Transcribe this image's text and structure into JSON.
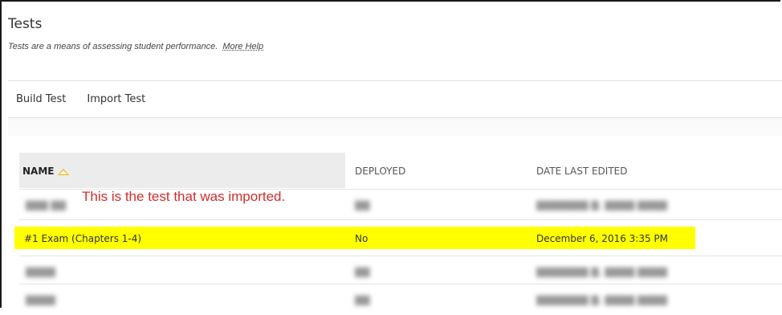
{
  "page": {
    "title": "Tests",
    "description": "Tests are a means of assessing student performance.",
    "more_help": "More Help"
  },
  "toolbar": {
    "build_test": "Build Test",
    "import_test": "Import Test"
  },
  "table": {
    "columns": {
      "name": "NAME",
      "deployed": "DEPLOYED",
      "date": "DATE LAST EDITED"
    },
    "sort_icon": "triangle-up-icon",
    "highlighted_row": {
      "name": "#1 Exam (Chapters 1-4)",
      "deployed": "No",
      "date": "December 6, 2016 3:35 PM"
    }
  },
  "annotation": "This is the test that was imported.",
  "colors": {
    "highlight": "#ffff00",
    "annotation": "#d22c2c"
  }
}
